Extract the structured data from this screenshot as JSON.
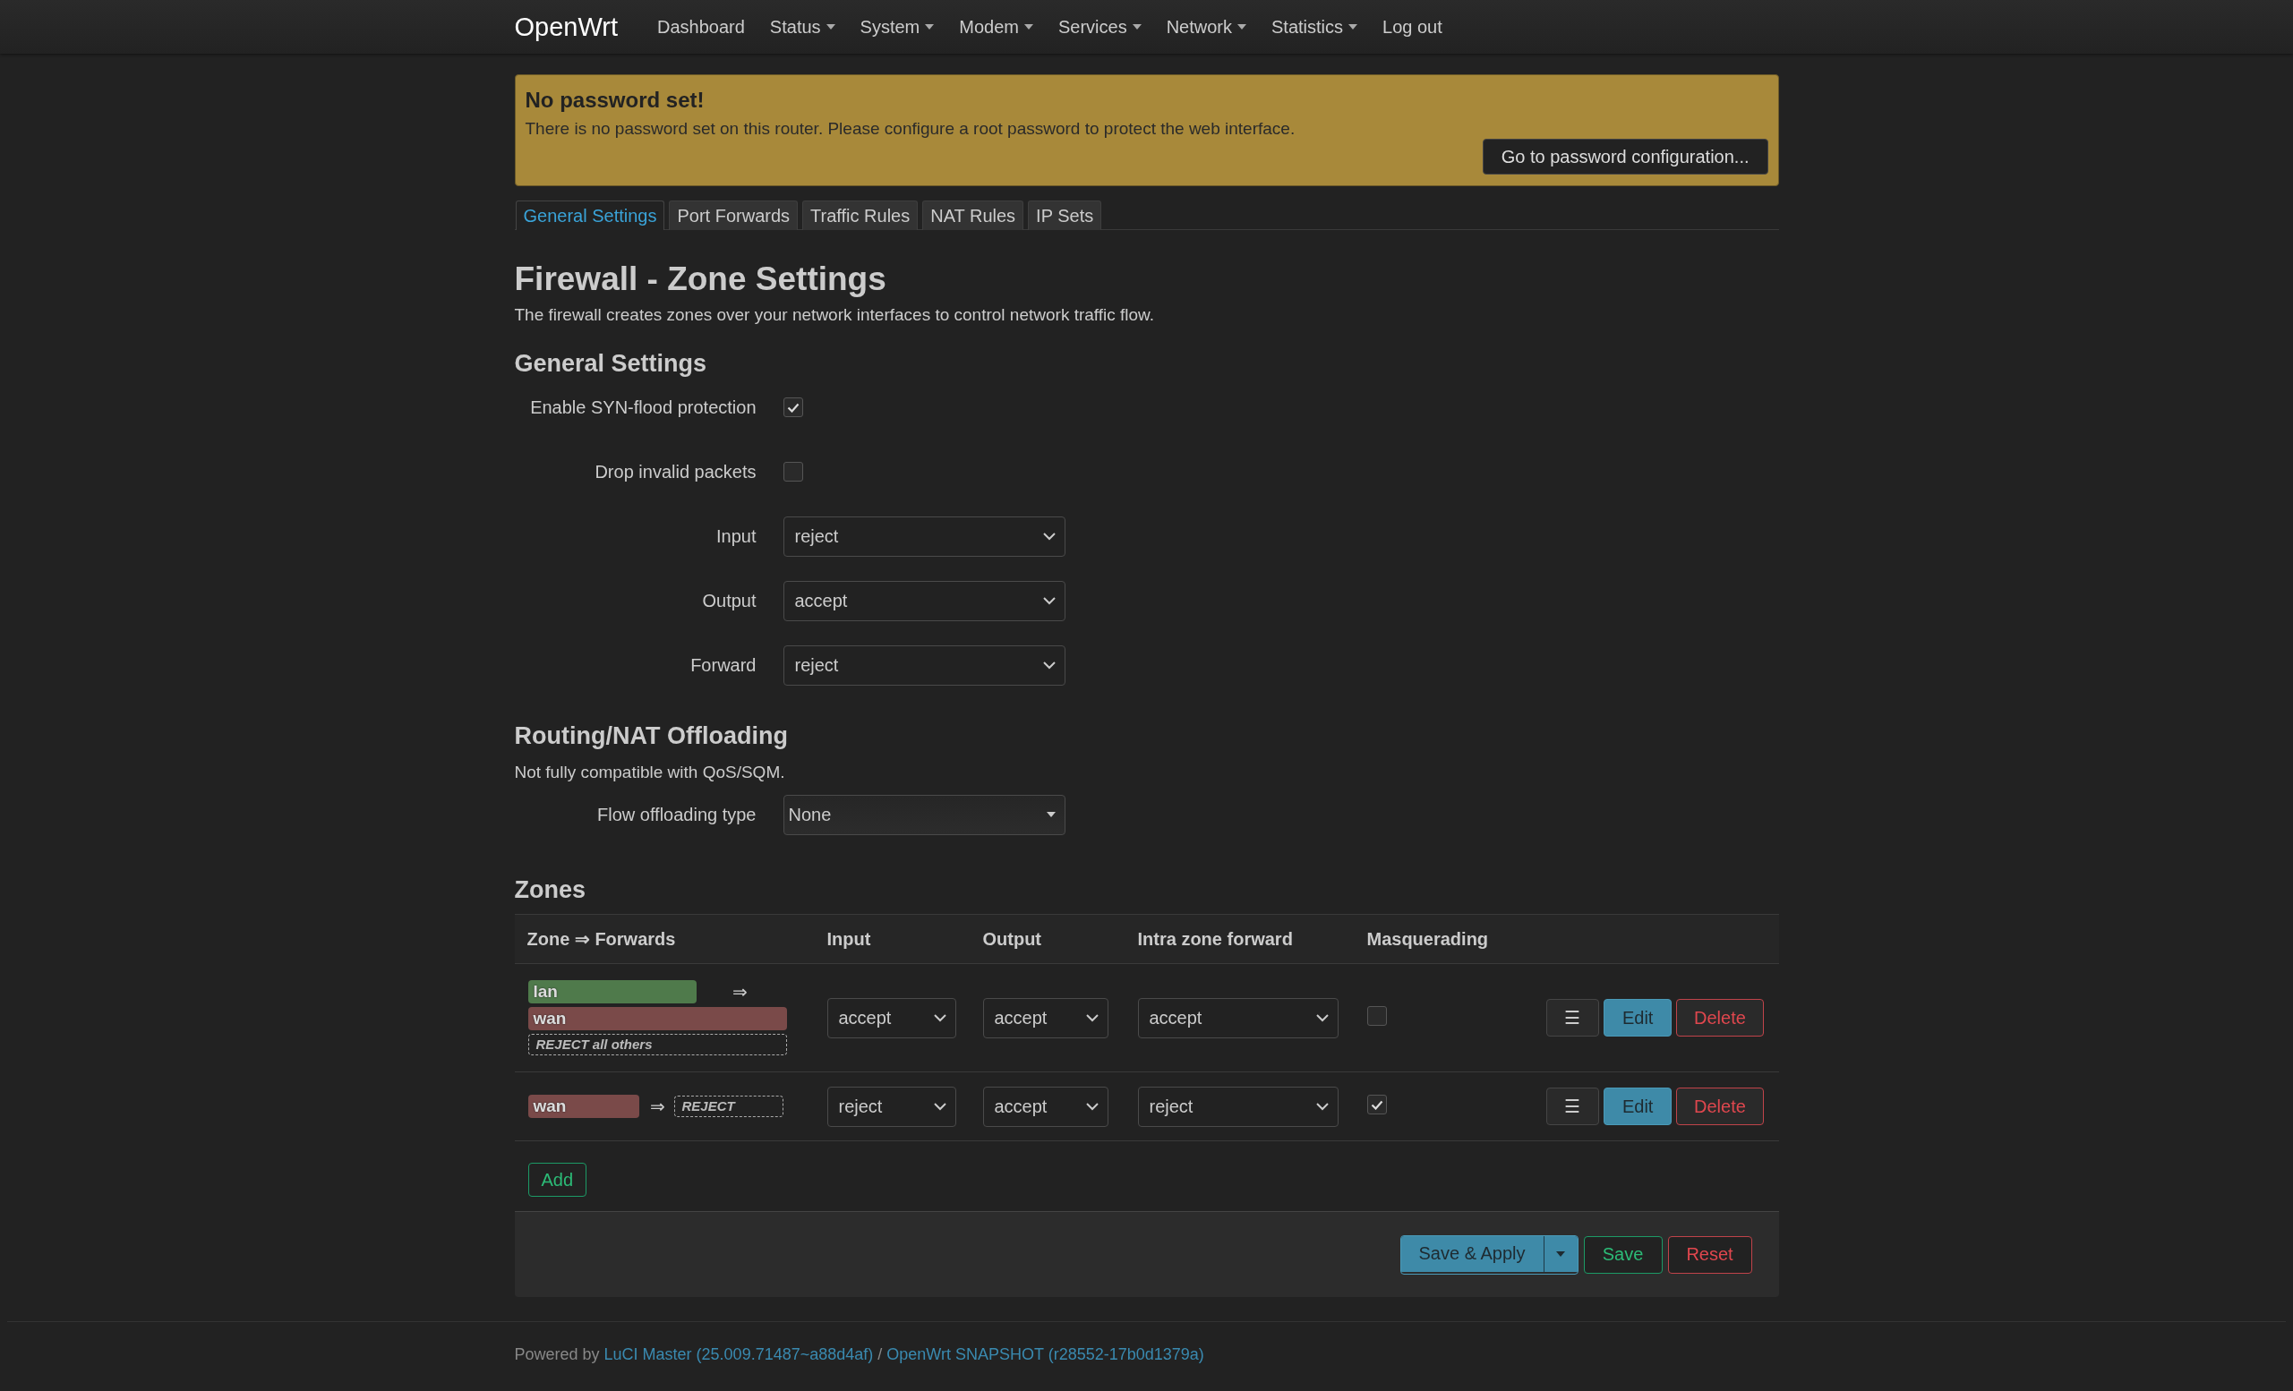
{
  "navbar": {
    "brand": "OpenWrt",
    "items": [
      {
        "label": "Dashboard",
        "has_menu": false
      },
      {
        "label": "Status",
        "has_menu": true
      },
      {
        "label": "System",
        "has_menu": true
      },
      {
        "label": "Modem",
        "has_menu": true
      },
      {
        "label": "Services",
        "has_menu": true
      },
      {
        "label": "Network",
        "has_menu": true
      },
      {
        "label": "Statistics",
        "has_menu": true
      },
      {
        "label": "Log out",
        "has_menu": false
      }
    ]
  },
  "alert": {
    "title": "No password set!",
    "message": "There is no password set on this router. Please configure a root password to protect the web interface.",
    "button": "Go to password configuration..."
  },
  "tabs": [
    {
      "label": "General Settings",
      "selected": true
    },
    {
      "label": "Port Forwards",
      "selected": false
    },
    {
      "label": "Traffic Rules",
      "selected": false
    },
    {
      "label": "NAT Rules",
      "selected": false
    },
    {
      "label": "IP Sets",
      "selected": false
    }
  ],
  "page": {
    "title": "Firewall - Zone Settings",
    "description": "The firewall creates zones over your network interfaces to control network traffic flow."
  },
  "general_settings": {
    "title": "General Settings",
    "fields": [
      {
        "kind": "checkbox",
        "label": "Enable SYN-flood protection",
        "checked": true
      },
      {
        "kind": "checkbox",
        "label": "Drop invalid packets",
        "checked": false
      },
      {
        "kind": "select",
        "label": "Input",
        "value": "reject"
      },
      {
        "kind": "select",
        "label": "Output",
        "value": "accept"
      },
      {
        "kind": "select",
        "label": "Forward",
        "value": "reject"
      }
    ]
  },
  "offloading": {
    "title": "Routing/NAT Offloading",
    "note": "Not fully compatible with QoS/SQM.",
    "fields": [
      {
        "kind": "dropdown",
        "label": "Flow offloading type",
        "value": "None"
      }
    ]
  },
  "zones": {
    "title": "Zones",
    "columns": [
      "Zone ⇒ Forwards",
      "Input",
      "Output",
      "Intra zone forward",
      "Masquerading"
    ],
    "rows": [
      {
        "kind": "stacked",
        "zone": {
          "name": "lan",
          "color": "#4f7a4b"
        },
        "arrow": "⇒",
        "forwards": [
          {
            "name": "wan",
            "color": "#7a4a49"
          }
        ],
        "fallback": "REJECT all others",
        "input": "accept",
        "output": "accept",
        "intra_zone_forward": "accept",
        "masquerading": false,
        "menu_button": "☰",
        "edit_button": "Edit",
        "delete_button": "Delete"
      },
      {
        "kind": "inline",
        "zone": {
          "name": "wan",
          "color": "#7a4a49"
        },
        "arrow": "⇒",
        "forwards": [],
        "fallback": "REJECT",
        "input": "reject",
        "output": "accept",
        "intra_zone_forward": "reject",
        "masquerading": true,
        "menu_button": "☰",
        "edit_button": "Edit",
        "delete_button": "Delete"
      }
    ],
    "add_button": "Add"
  },
  "actions": {
    "save_apply": "Save & Apply",
    "save": "Save",
    "reset": "Reset"
  },
  "footer": {
    "prefix": "Powered by",
    "links": [
      "LuCI Master (25.009.71487~a88d4af)",
      "OpenWrt SNAPSHOT (r28552-17b0d1379a)"
    ],
    "separator": "/"
  }
}
